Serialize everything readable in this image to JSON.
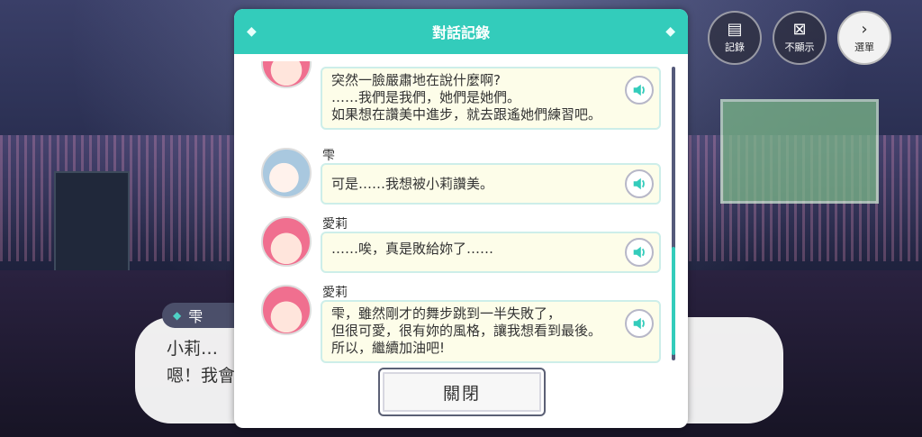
{
  "background": {
    "speaker_name": "雫",
    "dialogue_lines": [
      "小莉…",
      "嗯！我會"
    ]
  },
  "top_controls": {
    "log_label": "記錄",
    "hide_label": "不顯示",
    "skip_label": "選單"
  },
  "log_modal": {
    "title": "對話記錄",
    "close_label": "關閉",
    "accent_color": "#33ccbb",
    "entries": [
      {
        "speaker": "",
        "avatar": "airi",
        "lines": [
          "突然一臉嚴肅地在說什麼啊?",
          "……我們是我們，她們是她們。",
          "如果想在讚美中進步，就去跟遙她們練習吧。"
        ]
      },
      {
        "speaker": "雫",
        "avatar": "shizuku",
        "lines": [
          "可是……我想被小莉讚美。"
        ]
      },
      {
        "speaker": "愛莉",
        "avatar": "airi",
        "lines": [
          "……唉，真是敗給妳了……"
        ]
      },
      {
        "speaker": "愛莉",
        "avatar": "airi",
        "lines": [
          "雫，雖然剛才的舞步跳到一半失敗了，",
          "但很可愛，很有妳的風格，讓我想看到最後。",
          "所以，繼續加油吧!"
        ]
      }
    ]
  },
  "icons": {
    "voice": "speaker-icon",
    "log": "log-icon",
    "hide": "hide-icon",
    "skip": "skip-icon"
  }
}
